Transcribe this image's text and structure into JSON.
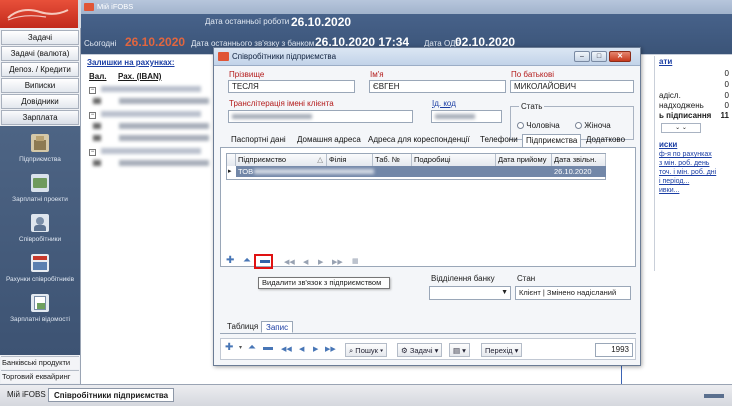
{
  "app": {
    "title": "Мій iFOBS"
  },
  "header": {
    "today_label": "Сьогодні",
    "today_value": "26.10.2020",
    "last_work_label": "Дата останньої роботи",
    "last_work_value": "26.10.2020",
    "last_bank_label": "Дата останнього зв'язку з банком",
    "last_bank_value": "26.10.2020 17:34",
    "ods_label": "Дата ОДБ",
    "ods_value": "02.10.2020"
  },
  "sidebar": {
    "top_buttons": [
      "Задачі",
      "Задачі (валюта)",
      "Депоз. / Кредити",
      "Виписки",
      "Довідники",
      "Зарплата"
    ],
    "dark_items": [
      "Підприємства",
      "Зарплатні проекти",
      "Співробітники",
      "Рахунки співробітників",
      "Зарплатні відомості"
    ],
    "bottom_buttons": [
      "Банківські продукти",
      "Торговий еквайринг"
    ]
  },
  "main": {
    "balances_title": "Залишки на рахунках:",
    "col_currency": "Вал.",
    "col_account": "Рах. (IBAN)"
  },
  "right_panel": {
    "title": "ати",
    "rows": [
      {
        "label": "",
        "value": "0"
      },
      {
        "label": "",
        "value": "0"
      },
      {
        "label": "адісл.",
        "value": "0"
      },
      {
        "label": "надходжень",
        "value": "0"
      },
      {
        "label": "ь підписання",
        "value": "11"
      }
    ],
    "links_title": "иски",
    "links": [
      "ф-я по рахунках",
      "з мін. роб. день",
      "точ. і мін. роб. дні",
      "і період...",
      "ивки..."
    ]
  },
  "dialog": {
    "title": "Співробітники підприємства",
    "surname_label": "Прізвище",
    "surname_value": "ТЕСЛЯ",
    "name_label": "Ім'я",
    "name_value": "ЄВГЕН",
    "patronymic_label": "По батькові",
    "patronymic_value": "МИКОЛАЙОВИЧ",
    "translit_label": "Транслітерація імені клієнта",
    "id_code_label": "Ід. код",
    "gender_label": "Стать",
    "gender_male": "Чоловіча",
    "gender_female": "Жіноча",
    "tabs": [
      "Паспортні дані",
      "Домашня адреса",
      "Адреса для кореспонденції",
      "Телефони",
      "Підприємства",
      "Додатково"
    ],
    "selected_tab": "Підприємства",
    "grid_headers": [
      "Підприємство",
      "Філія",
      "Таб. №",
      "Подробиці",
      "Дата прийому",
      "Дата звільн."
    ],
    "grid_row": {
      "company": "ТОВ",
      "dismissal_date": "26.10.2020"
    },
    "tooltip": "Видалити зв'язок з підприємством",
    "branch_label": "Відділення банку",
    "state_label": "Стан",
    "state_value": "Клієнт | Змінено надісланий",
    "bottom_tabs": [
      "Таблиця",
      "Запис"
    ],
    "selected_bottom_tab": "Запис",
    "toolbar": {
      "search_label": "Пошук",
      "tasks_label": "Задачі",
      "goto_label": "Перехід",
      "record_number": "1993"
    }
  },
  "statusbar": {
    "tabs": [
      "Мій iFOBS",
      "Співробітники підприємства"
    ],
    "selected": "Співробітники підприємства"
  },
  "colors": {
    "header_blue": "#3b5478",
    "accent_red": "#e2663f",
    "selection": "#7287a8",
    "highlight_box": "#e01212"
  }
}
